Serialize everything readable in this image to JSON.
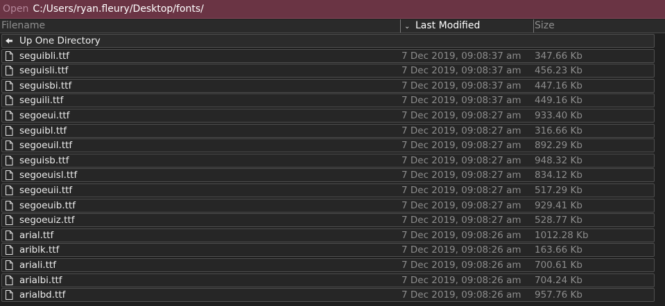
{
  "titlebar": {
    "label": "Open",
    "path": "C:/Users/ryan.fleury/Desktop/fonts/"
  },
  "columns": {
    "filename": "Filename",
    "last_modified": "Last Modified",
    "size": "Size",
    "sort_indicator_icon": "chevron-down-icon"
  },
  "up_directory": {
    "label": "Up One Directory",
    "icon": "arrow-left-icon"
  },
  "files": [
    {
      "name": "seguibli.ttf",
      "modified": "7 Dec 2019, 09:08:37 am",
      "size": "347.66 Kb"
    },
    {
      "name": "seguisli.ttf",
      "modified": "7 Dec 2019, 09:08:37 am",
      "size": "456.23 Kb"
    },
    {
      "name": "seguisbi.ttf",
      "modified": "7 Dec 2019, 09:08:37 am",
      "size": "447.16 Kb"
    },
    {
      "name": "seguili.ttf",
      "modified": "7 Dec 2019, 09:08:37 am",
      "size": "449.16 Kb"
    },
    {
      "name": "segoeui.ttf",
      "modified": "7 Dec 2019, 09:08:27 am",
      "size": "933.40 Kb"
    },
    {
      "name": "seguibl.ttf",
      "modified": "7 Dec 2019, 09:08:27 am",
      "size": "316.66 Kb"
    },
    {
      "name": "segoeuil.ttf",
      "modified": "7 Dec 2019, 09:08:27 am",
      "size": "892.29 Kb"
    },
    {
      "name": "seguisb.ttf",
      "modified": "7 Dec 2019, 09:08:27 am",
      "size": "948.32 Kb"
    },
    {
      "name": "segoeuisl.ttf",
      "modified": "7 Dec 2019, 09:08:27 am",
      "size": "834.12 Kb"
    },
    {
      "name": "segoeuii.ttf",
      "modified": "7 Dec 2019, 09:08:27 am",
      "size": "517.29 Kb"
    },
    {
      "name": "segoeuib.ttf",
      "modified": "7 Dec 2019, 09:08:27 am",
      "size": "929.41 Kb"
    },
    {
      "name": "segoeuiz.ttf",
      "modified": "7 Dec 2019, 09:08:27 am",
      "size": "528.77 Kb"
    },
    {
      "name": "arial.ttf",
      "modified": "7 Dec 2019, 09:08:26 am",
      "size": "1012.28 Kb"
    },
    {
      "name": "ariblk.ttf",
      "modified": "7 Dec 2019, 09:08:26 am",
      "size": "163.66 Kb"
    },
    {
      "name": "ariali.ttf",
      "modified": "7 Dec 2019, 09:08:26 am",
      "size": "700.61 Kb"
    },
    {
      "name": "arialbi.ttf",
      "modified": "7 Dec 2019, 09:08:26 am",
      "size": "704.24 Kb"
    },
    {
      "name": "arialbd.ttf",
      "modified": "7 Dec 2019, 09:08:26 am",
      "size": "957.76 Kb"
    }
  ],
  "file_icon": "file-icon",
  "colors": {
    "titlebar_bg": "#6a3444",
    "background": "#1f1f1f",
    "row_border": "#505050"
  }
}
